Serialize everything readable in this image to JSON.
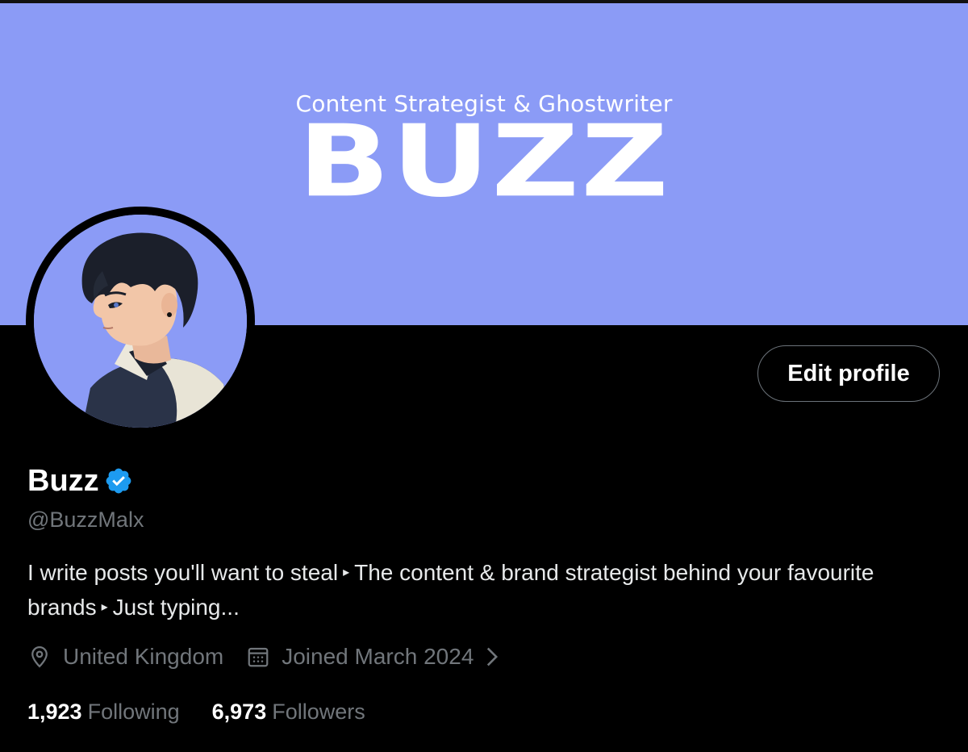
{
  "banner": {
    "subtitle": "Content Strategist & Ghostwriter",
    "title": "BUZZ",
    "background_color": "#8b9bf6"
  },
  "profile": {
    "display_name": "Buzz",
    "verified_icon": "verified-badge-icon",
    "verified_color": "#1d9bf0",
    "handle": "@BuzzMalx",
    "avatar_icon": "anime-character-avatar"
  },
  "actions": {
    "edit_profile_label": "Edit profile"
  },
  "bio": {
    "part1": "I write posts you'll want to steal",
    "separator": "▸",
    "part2": "The content & brand strategist behind your favourite brands",
    "part3": "Just typing..."
  },
  "meta": {
    "location_icon": "location-pin-icon",
    "location": "United Kingdom",
    "joined_icon": "calendar-icon",
    "joined": "Joined March 2024",
    "joined_chevron_icon": "chevron-right-icon"
  },
  "stats": {
    "following_count": "1,923",
    "following_label": "Following",
    "followers_count": "6,973",
    "followers_label": "Followers"
  }
}
